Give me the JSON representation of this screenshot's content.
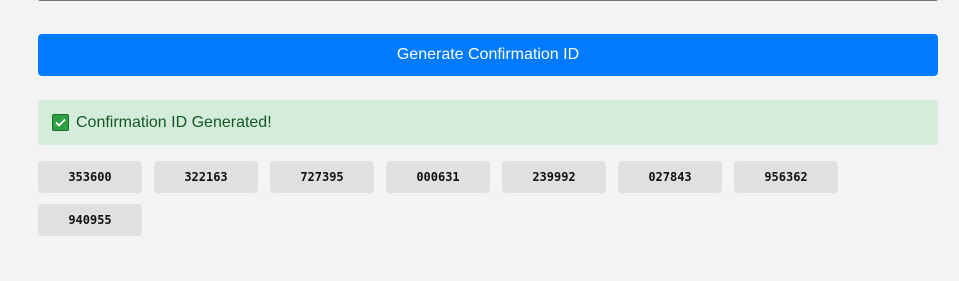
{
  "actions": {
    "generate_label": "Generate Confirmation ID"
  },
  "status": {
    "message": "Confirmation ID Generated!",
    "icon": "check-mark-icon",
    "color": "#155724",
    "background": "#d4edda"
  },
  "theme": {
    "accent": "#007bff",
    "chip_background": "#e0e0e0",
    "page_background": "#f3f3f3"
  },
  "confirmation_ids": [
    "353600",
    "322163",
    "727395",
    "000631",
    "239992",
    "027843",
    "956362",
    "940955"
  ]
}
